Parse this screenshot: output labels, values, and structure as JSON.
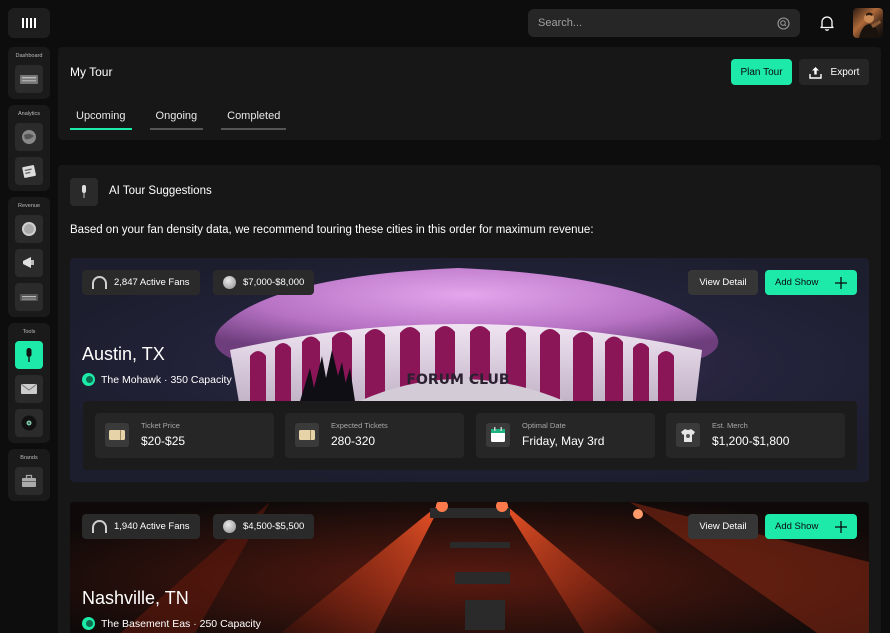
{
  "header": {
    "search_placeholder": "Search...",
    "icons": [
      "logo-icon",
      "search-icon",
      "bell-icon",
      "avatar"
    ]
  },
  "sidebar": {
    "groups": [
      {
        "label": "Dashboard"
      },
      {
        "label": "Analytics"
      },
      {
        "label": "Revenue"
      },
      {
        "label": "Tools"
      },
      {
        "label": "Brands"
      }
    ]
  },
  "page": {
    "title": "My Tour",
    "plan_label": "Plan Tour",
    "export_label": "Export",
    "tabs": [
      {
        "label": "Upcoming",
        "active": true
      },
      {
        "label": "Ongoing",
        "active": false
      },
      {
        "label": "Completed",
        "active": false
      }
    ]
  },
  "suggestions": {
    "title": "AI Tour Suggestions",
    "description": "Based on your fan density data, we recommend touring these cities in this order for maximum revenue:",
    "view_label": "View Detail",
    "add_label": "Add Show",
    "cards": [
      {
        "city": "Austin, TX",
        "venue": "The Mohawk · 350 Capacity",
        "fans": "2,847 Active Fans",
        "revenue": "$7,000-$8,000",
        "sign_text": "FORUM CLUB",
        "stats": [
          {
            "label": "Ticket Price",
            "value": "$20-$25",
            "icon": "ticket-icon"
          },
          {
            "label": "Expected Tickets",
            "value": "280-320",
            "icon": "ticket-icon"
          },
          {
            "label": "Optimal Date",
            "value": "Friday, May 3rd",
            "icon": "calendar-icon"
          },
          {
            "label": "Est. Merch",
            "value": "$1,200-$1,800",
            "icon": "tshirt-icon"
          }
        ]
      },
      {
        "city": "Nashville, TN",
        "venue": "The Basement Eas · 250 Capacity",
        "fans": "1,940 Active Fans",
        "revenue": "$4,500-$5,500"
      }
    ]
  },
  "colors": {
    "accent": "#1de9a8",
    "background": "#0d0d0d",
    "panel": "#171717"
  }
}
